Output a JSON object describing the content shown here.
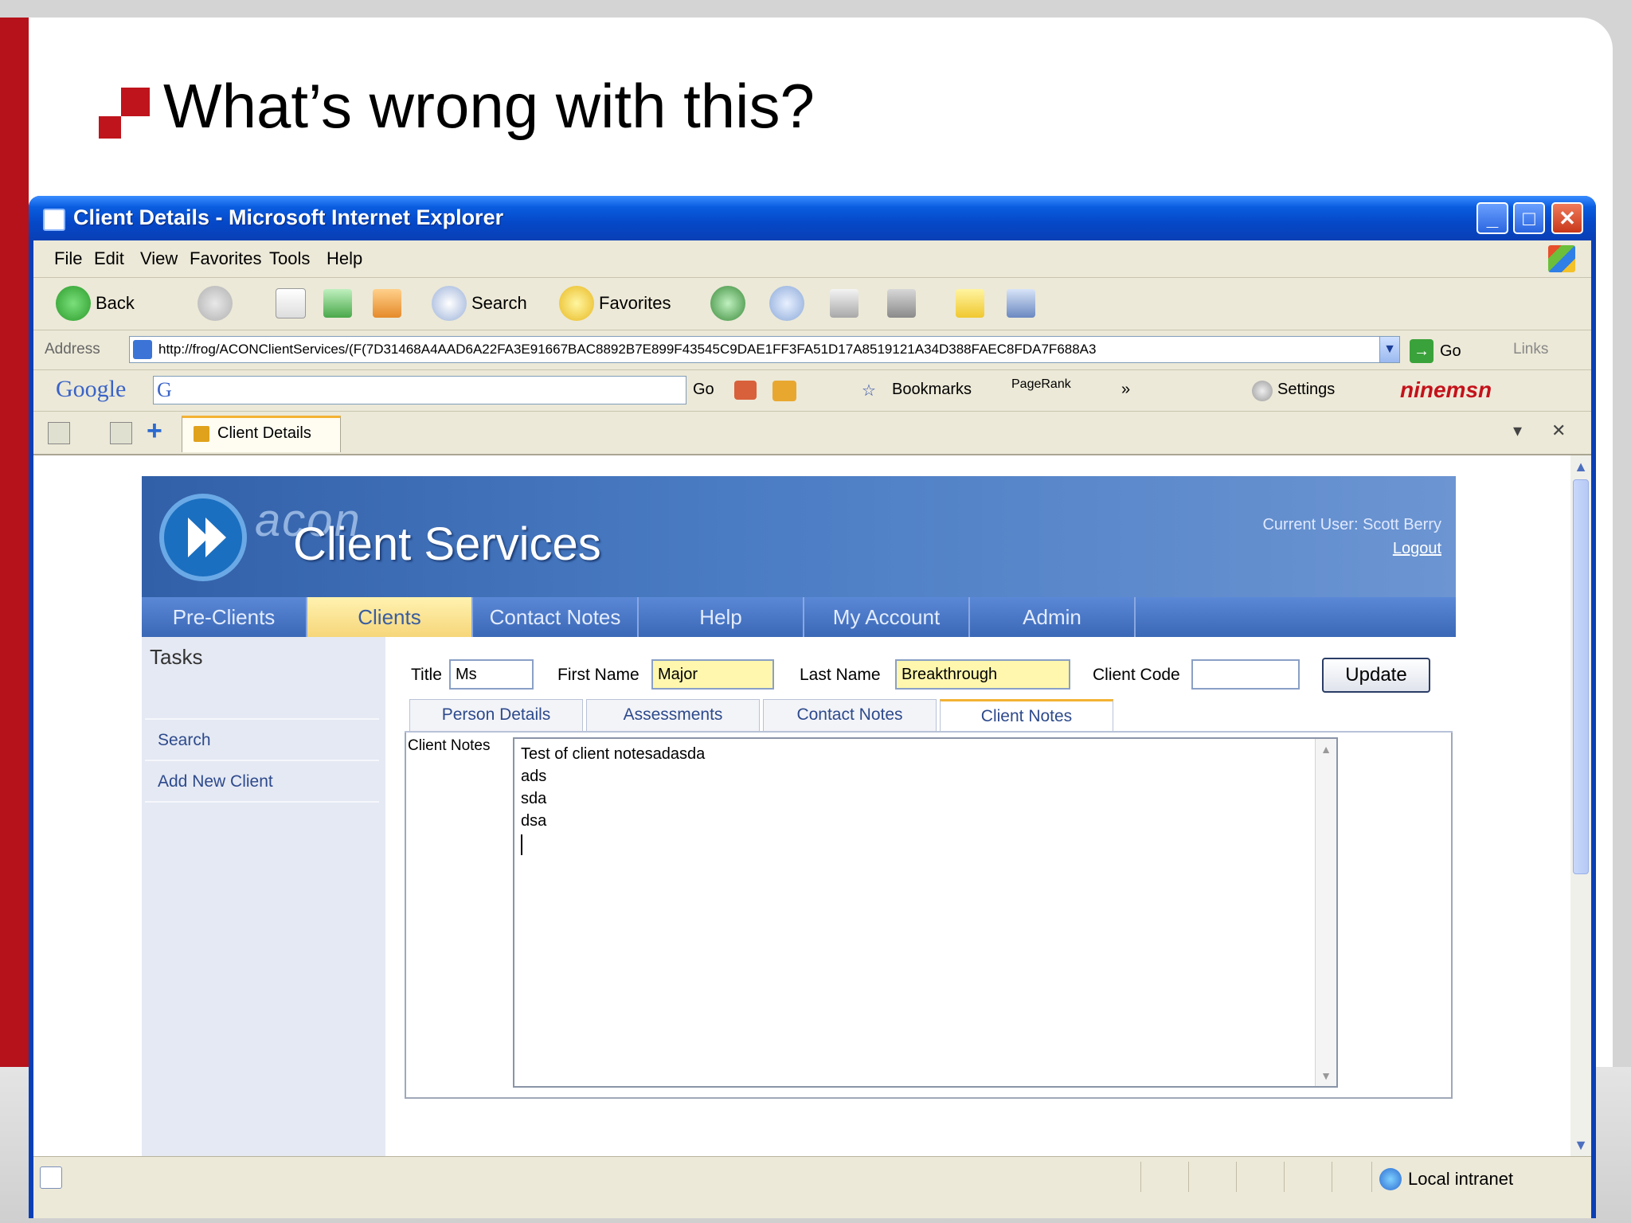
{
  "slide": {
    "title": "What’s wrong with this?",
    "accent_color": "#b5121b"
  },
  "window": {
    "title": "Client Details - Microsoft Internet Explorer",
    "controls": {
      "minimize": "_",
      "maximize": "□",
      "close": "✕"
    }
  },
  "menubar": [
    "File",
    "Edit",
    "View",
    "Favorites",
    "Tools",
    "Help"
  ],
  "toolbar": {
    "back": "Back",
    "search": "Search",
    "favorites": "Favorites"
  },
  "address": {
    "label": "Address",
    "url": "http://frog/ACONClientServices/(F(7D31468A4AAD6A22FA3E91667BAC8892B7E899F43545C9DAE1FF3FA51D17A8519121A34D388FAEC8FDA7F688A3",
    "go": "Go",
    "links": "Links"
  },
  "googlebar": {
    "logo": "Google",
    "go": "Go",
    "bookmarks": "Bookmarks",
    "pagerank": "PageRank",
    "more": "»",
    "settings": "Settings",
    "ninemsn": "ninemsn"
  },
  "tabs": {
    "current": "Client Details"
  },
  "app": {
    "brand": "acon",
    "title": "Client Services",
    "current_user": "Current User: Scott Berry",
    "logout": "Logout",
    "nav": [
      "Pre-Clients",
      "Clients",
      "Contact Notes",
      "Help",
      "My Account",
      "Admin"
    ],
    "nav_active": "Clients",
    "tasks": {
      "title": "Tasks",
      "links": [
        "Search",
        "Add New Client"
      ]
    },
    "form": {
      "title_label": "Title",
      "title_value": "Ms",
      "first_name_label": "First Name",
      "first_name_value": "Major",
      "last_name_label": "Last Name",
      "last_name_value": "Breakthrough",
      "client_code_label": "Client Code",
      "client_code_value": "",
      "update": "Update"
    },
    "form_tabs": [
      "Person Details",
      "Assessments",
      "Contact Notes",
      "Client Notes"
    ],
    "form_tab_active": "Client Notes",
    "notes": {
      "label": "Client Notes",
      "lines": [
        "Test of client notesadasda",
        "ads",
        "sda",
        "dsa"
      ]
    }
  },
  "statusbar": {
    "zone": "Local intranet"
  }
}
